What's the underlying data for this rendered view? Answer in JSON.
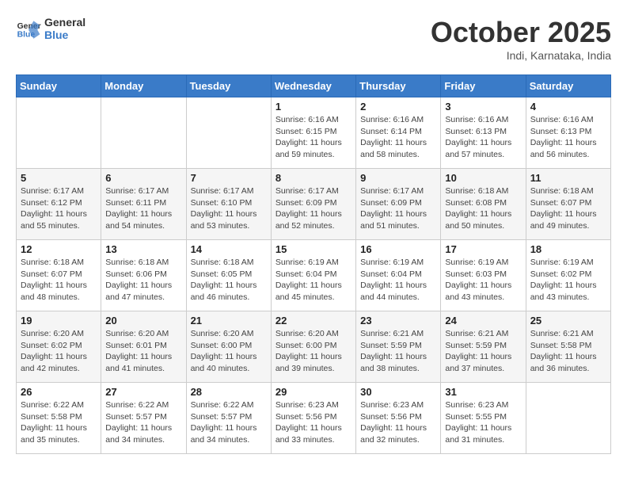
{
  "header": {
    "logo_general": "General",
    "logo_blue": "Blue",
    "month": "October 2025",
    "location": "Indi, Karnataka, India"
  },
  "weekdays": [
    "Sunday",
    "Monday",
    "Tuesday",
    "Wednesday",
    "Thursday",
    "Friday",
    "Saturday"
  ],
  "weeks": [
    [
      {
        "day": "",
        "info": ""
      },
      {
        "day": "",
        "info": ""
      },
      {
        "day": "",
        "info": ""
      },
      {
        "day": "1",
        "info": "Sunrise: 6:16 AM\nSunset: 6:15 PM\nDaylight: 11 hours\nand 59 minutes."
      },
      {
        "day": "2",
        "info": "Sunrise: 6:16 AM\nSunset: 6:14 PM\nDaylight: 11 hours\nand 58 minutes."
      },
      {
        "day": "3",
        "info": "Sunrise: 6:16 AM\nSunset: 6:13 PM\nDaylight: 11 hours\nand 57 minutes."
      },
      {
        "day": "4",
        "info": "Sunrise: 6:16 AM\nSunset: 6:13 PM\nDaylight: 11 hours\nand 56 minutes."
      }
    ],
    [
      {
        "day": "5",
        "info": "Sunrise: 6:17 AM\nSunset: 6:12 PM\nDaylight: 11 hours\nand 55 minutes."
      },
      {
        "day": "6",
        "info": "Sunrise: 6:17 AM\nSunset: 6:11 PM\nDaylight: 11 hours\nand 54 minutes."
      },
      {
        "day": "7",
        "info": "Sunrise: 6:17 AM\nSunset: 6:10 PM\nDaylight: 11 hours\nand 53 minutes."
      },
      {
        "day": "8",
        "info": "Sunrise: 6:17 AM\nSunset: 6:09 PM\nDaylight: 11 hours\nand 52 minutes."
      },
      {
        "day": "9",
        "info": "Sunrise: 6:17 AM\nSunset: 6:09 PM\nDaylight: 11 hours\nand 51 minutes."
      },
      {
        "day": "10",
        "info": "Sunrise: 6:18 AM\nSunset: 6:08 PM\nDaylight: 11 hours\nand 50 minutes."
      },
      {
        "day": "11",
        "info": "Sunrise: 6:18 AM\nSunset: 6:07 PM\nDaylight: 11 hours\nand 49 minutes."
      }
    ],
    [
      {
        "day": "12",
        "info": "Sunrise: 6:18 AM\nSunset: 6:07 PM\nDaylight: 11 hours\nand 48 minutes."
      },
      {
        "day": "13",
        "info": "Sunrise: 6:18 AM\nSunset: 6:06 PM\nDaylight: 11 hours\nand 47 minutes."
      },
      {
        "day": "14",
        "info": "Sunrise: 6:18 AM\nSunset: 6:05 PM\nDaylight: 11 hours\nand 46 minutes."
      },
      {
        "day": "15",
        "info": "Sunrise: 6:19 AM\nSunset: 6:04 PM\nDaylight: 11 hours\nand 45 minutes."
      },
      {
        "day": "16",
        "info": "Sunrise: 6:19 AM\nSunset: 6:04 PM\nDaylight: 11 hours\nand 44 minutes."
      },
      {
        "day": "17",
        "info": "Sunrise: 6:19 AM\nSunset: 6:03 PM\nDaylight: 11 hours\nand 43 minutes."
      },
      {
        "day": "18",
        "info": "Sunrise: 6:19 AM\nSunset: 6:02 PM\nDaylight: 11 hours\nand 43 minutes."
      }
    ],
    [
      {
        "day": "19",
        "info": "Sunrise: 6:20 AM\nSunset: 6:02 PM\nDaylight: 11 hours\nand 42 minutes."
      },
      {
        "day": "20",
        "info": "Sunrise: 6:20 AM\nSunset: 6:01 PM\nDaylight: 11 hours\nand 41 minutes."
      },
      {
        "day": "21",
        "info": "Sunrise: 6:20 AM\nSunset: 6:00 PM\nDaylight: 11 hours\nand 40 minutes."
      },
      {
        "day": "22",
        "info": "Sunrise: 6:20 AM\nSunset: 6:00 PM\nDaylight: 11 hours\nand 39 minutes."
      },
      {
        "day": "23",
        "info": "Sunrise: 6:21 AM\nSunset: 5:59 PM\nDaylight: 11 hours\nand 38 minutes."
      },
      {
        "day": "24",
        "info": "Sunrise: 6:21 AM\nSunset: 5:59 PM\nDaylight: 11 hours\nand 37 minutes."
      },
      {
        "day": "25",
        "info": "Sunrise: 6:21 AM\nSunset: 5:58 PM\nDaylight: 11 hours\nand 36 minutes."
      }
    ],
    [
      {
        "day": "26",
        "info": "Sunrise: 6:22 AM\nSunset: 5:58 PM\nDaylight: 11 hours\nand 35 minutes."
      },
      {
        "day": "27",
        "info": "Sunrise: 6:22 AM\nSunset: 5:57 PM\nDaylight: 11 hours\nand 34 minutes."
      },
      {
        "day": "28",
        "info": "Sunrise: 6:22 AM\nSunset: 5:57 PM\nDaylight: 11 hours\nand 34 minutes."
      },
      {
        "day": "29",
        "info": "Sunrise: 6:23 AM\nSunset: 5:56 PM\nDaylight: 11 hours\nand 33 minutes."
      },
      {
        "day": "30",
        "info": "Sunrise: 6:23 AM\nSunset: 5:56 PM\nDaylight: 11 hours\nand 32 minutes."
      },
      {
        "day": "31",
        "info": "Sunrise: 6:23 AM\nSunset: 5:55 PM\nDaylight: 11 hours\nand 31 minutes."
      },
      {
        "day": "",
        "info": ""
      }
    ]
  ]
}
